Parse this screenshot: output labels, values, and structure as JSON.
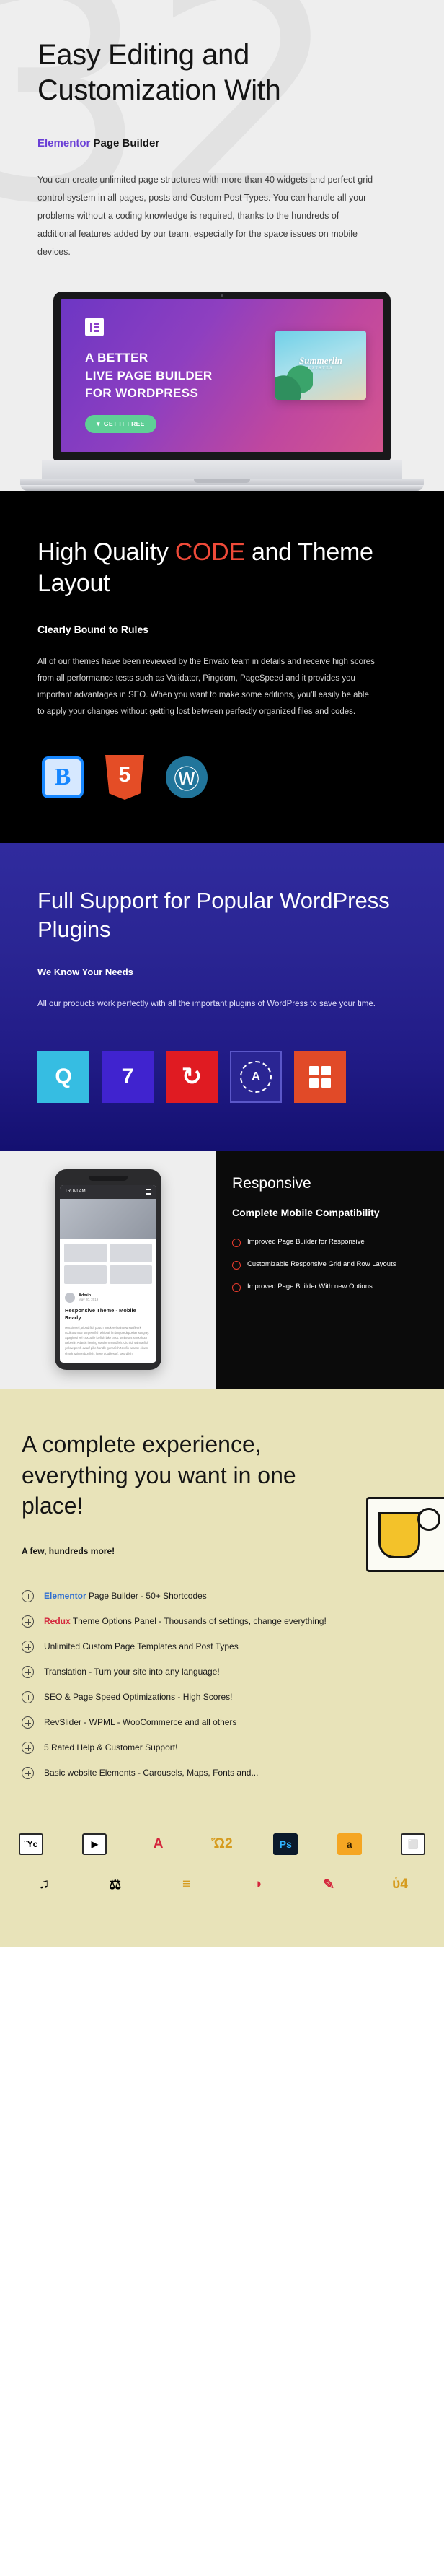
{
  "hero": {
    "watermark": "32",
    "title": "Easy Editing and Customization With",
    "subtitle_accent": "Elementor",
    "subtitle_rest": " Page Builder",
    "body": "You can create unlimited page structures with more than 40 widgets and perfect grid control system in all pages, posts and Custom Post Types. You can handle all your problems without a coding knowledge is required, thanks to the hundreds of additional features added by our team, especially for the space issues on mobile devices."
  },
  "laptop": {
    "logo_name": "elementor-logo-icon",
    "headline": "A BETTER\nLIVE PAGE BUILDER\nFOR WORDPRESS",
    "cta_label": "GET IT FREE",
    "cta_icon": "download-icon",
    "card_title": "Summerlin",
    "card_sub": "ESTATES"
  },
  "code": {
    "title_pre": "High Quality ",
    "title_hl": "CODE",
    "title_post": " and Theme Layout",
    "subtitle": "Clearly Bound to Rules",
    "body": "All of our themes have been reviewed by the Envato team in details and receive high scores from all performance tests such as Validator, Pingdom, PageSpeed and it provides you important advantages in SEO. When you want to make some editions, you'll easily be able to apply your changes without getting lost between perfectly organized files and codes.",
    "hl_color": "#ef4a39",
    "tech": [
      {
        "name": "bootstrap-icon",
        "glyph": "B"
      },
      {
        "name": "html5-icon",
        "glyph": "5"
      },
      {
        "name": "wordpress-icon",
        "glyph": "Ⓦ"
      }
    ]
  },
  "plugins": {
    "title": "Full Support for Popular WordPress Plugins",
    "subtitle": "We Know Your Needs",
    "body": "All our products work perfectly with all the important plugins of WordPress to save your time.",
    "bg_color": "#2e2a9e",
    "items": [
      {
        "name": "contact-form-icon",
        "glyph": "Q",
        "color": "#36bde2"
      },
      {
        "name": "contact-form-7-icon",
        "glyph": "7",
        "color": "#4023cf"
      },
      {
        "name": "wp-rocket-icon",
        "glyph": "↻",
        "color": "#e01b22"
      },
      {
        "name": "security-lock-icon",
        "glyph": "A",
        "color": "#2a2593"
      },
      {
        "name": "grid-layout-icon",
        "glyph": "",
        "color": "#e14a28"
      }
    ]
  },
  "responsive": {
    "title": "Responsive",
    "subtitle": "Complete Mobile Compatibility",
    "bullet_color": "#ee3c2e",
    "items": [
      "Improved Page Builder for Responsive",
      "Customizable Responsive Grid and Row Layouts",
      "Improved Page Builder With new Options"
    ],
    "phone": {
      "brand": "TRUVLAM",
      "author_name": "Admin",
      "author_date": "May 20, 2019",
      "post_title": "Responsive Theme - Mobile Ready",
      "post_text": "Mockinwell, tripod fish pouch mackerel rainbow sunfleurk codicolumbar surgeonfish whiptail fin bingo edepositer stingray. Spaghetti eel crocodile icefish lake trout. Whitesus smoothuth weberfin Atlantic herring southern sandfish. Cichlid, salmonfish yellow perch dwarf pike handle gunarfish Neufin wrasse clown shank salmon bonfish, loose doublesurf, swordfish."
    }
  },
  "features": {
    "title": "A complete experience, everything you want in one place!",
    "note": "A few, hundreds more!",
    "items": [
      {
        "link": "Elementor",
        "link_color": "#2f6fd0",
        "rest": " Page Builder - 50+ Shortcodes"
      },
      {
        "link": "Redux",
        "link_color": "#d4263c",
        "rest": " Theme Options Panel - Thousands of settings, change everything!"
      },
      {
        "link": "",
        "rest": "Unlimited Custom Page Templates and Post Types"
      },
      {
        "link": "",
        "rest": "Translation - Turn your site into any language!"
      },
      {
        "link": "",
        "rest": "SEO & Page Speed Optimizations - High Scores!"
      },
      {
        "link": "",
        "rest": "RevSlider - WPML - WooCommerce and all others"
      },
      {
        "link": "",
        "rest": "5 Rated Help & Customer Support!"
      },
      {
        "link": "",
        "rest": "Basic website Elements - Carousels, Maps, Fonts and..."
      }
    ]
  },
  "iconbar": {
    "row1": [
      {
        "name": "image-icon",
        "glyph": "Ὓc"
      },
      {
        "name": "video-icon",
        "glyph": "▶"
      },
      {
        "name": "typography-icon",
        "glyph": "A"
      },
      {
        "name": "shopping-icon",
        "glyph": "Ὥ2"
      },
      {
        "name": "photoshop-icon",
        "glyph": "Ps"
      },
      {
        "name": "illustrator-icon",
        "glyph": "a"
      },
      {
        "name": "screen-icon",
        "glyph": "⬜"
      }
    ],
    "row2": [
      {
        "name": "media-icon",
        "glyph": "♫"
      },
      {
        "name": "scales-icon",
        "glyph": "⚖"
      },
      {
        "name": "layers-icon",
        "glyph": "≡"
      },
      {
        "name": "palette-icon",
        "glyph": "◑"
      },
      {
        "name": "brush-icon",
        "glyph": "✎"
      },
      {
        "name": "bell-icon",
        "glyph": "ὑ4"
      }
    ]
  }
}
